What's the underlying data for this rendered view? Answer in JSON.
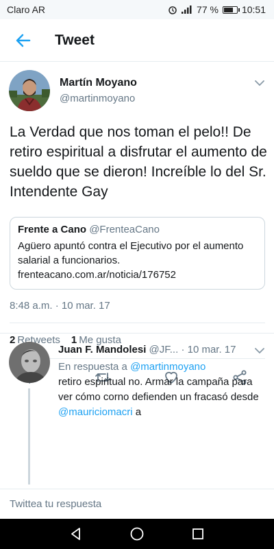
{
  "status_bar": {
    "carrier": "Claro AR",
    "battery": "77 %",
    "battery_level": 0.77,
    "time": "10:51"
  },
  "header": {
    "title": "Tweet"
  },
  "tweet": {
    "author_name": "Martín Moyano",
    "author_handle": "@martinmoyano",
    "text": "La Verdad que nos toman el pelo!! De retiro espiritual a disfrutar el aumento de sueldo que se dieron! Increíble lo del Sr. Intendente Gay",
    "quote": {
      "name": "Frente a Cano",
      "handle": "@FrenteaCano",
      "text": "Agüero apuntó contra el Ejecutivo por el aumento salarial a funcionarios. frenteacano.com.ar/noticia/176752"
    },
    "timestamp": "8:48 a.m. · 10 mar. 17",
    "retweets_count": "2",
    "retweets_label": "Retweets",
    "likes_count": "1",
    "likes_label": "Me gusta"
  },
  "reply": {
    "name": "Juan F. Mandolesi",
    "handle": "@JF...",
    "date": "· 10 mar. 17",
    "in_reply_prefix": "En respuesta a",
    "in_reply_mention": "@martinmoyano",
    "text_part1": "retiro espiritual no. Armar la campaña para ver cómo corno defienden un fracasó desde",
    "mention2": "@mauriciomacri",
    "text_part2": "a"
  },
  "compose": {
    "placeholder": "Twittea tu respuesta"
  },
  "colors": {
    "accent": "#1da1f2",
    "secondary_text": "#657786",
    "border": "#e6ecf0"
  },
  "icons": [
    "back-arrow-icon",
    "chevron-down-icon",
    "reply-icon",
    "retweet-icon",
    "heart-icon",
    "share-icon",
    "nav-back-icon",
    "nav-home-icon",
    "nav-recents-icon",
    "alarm-icon",
    "signal-icon",
    "battery-icon"
  ]
}
